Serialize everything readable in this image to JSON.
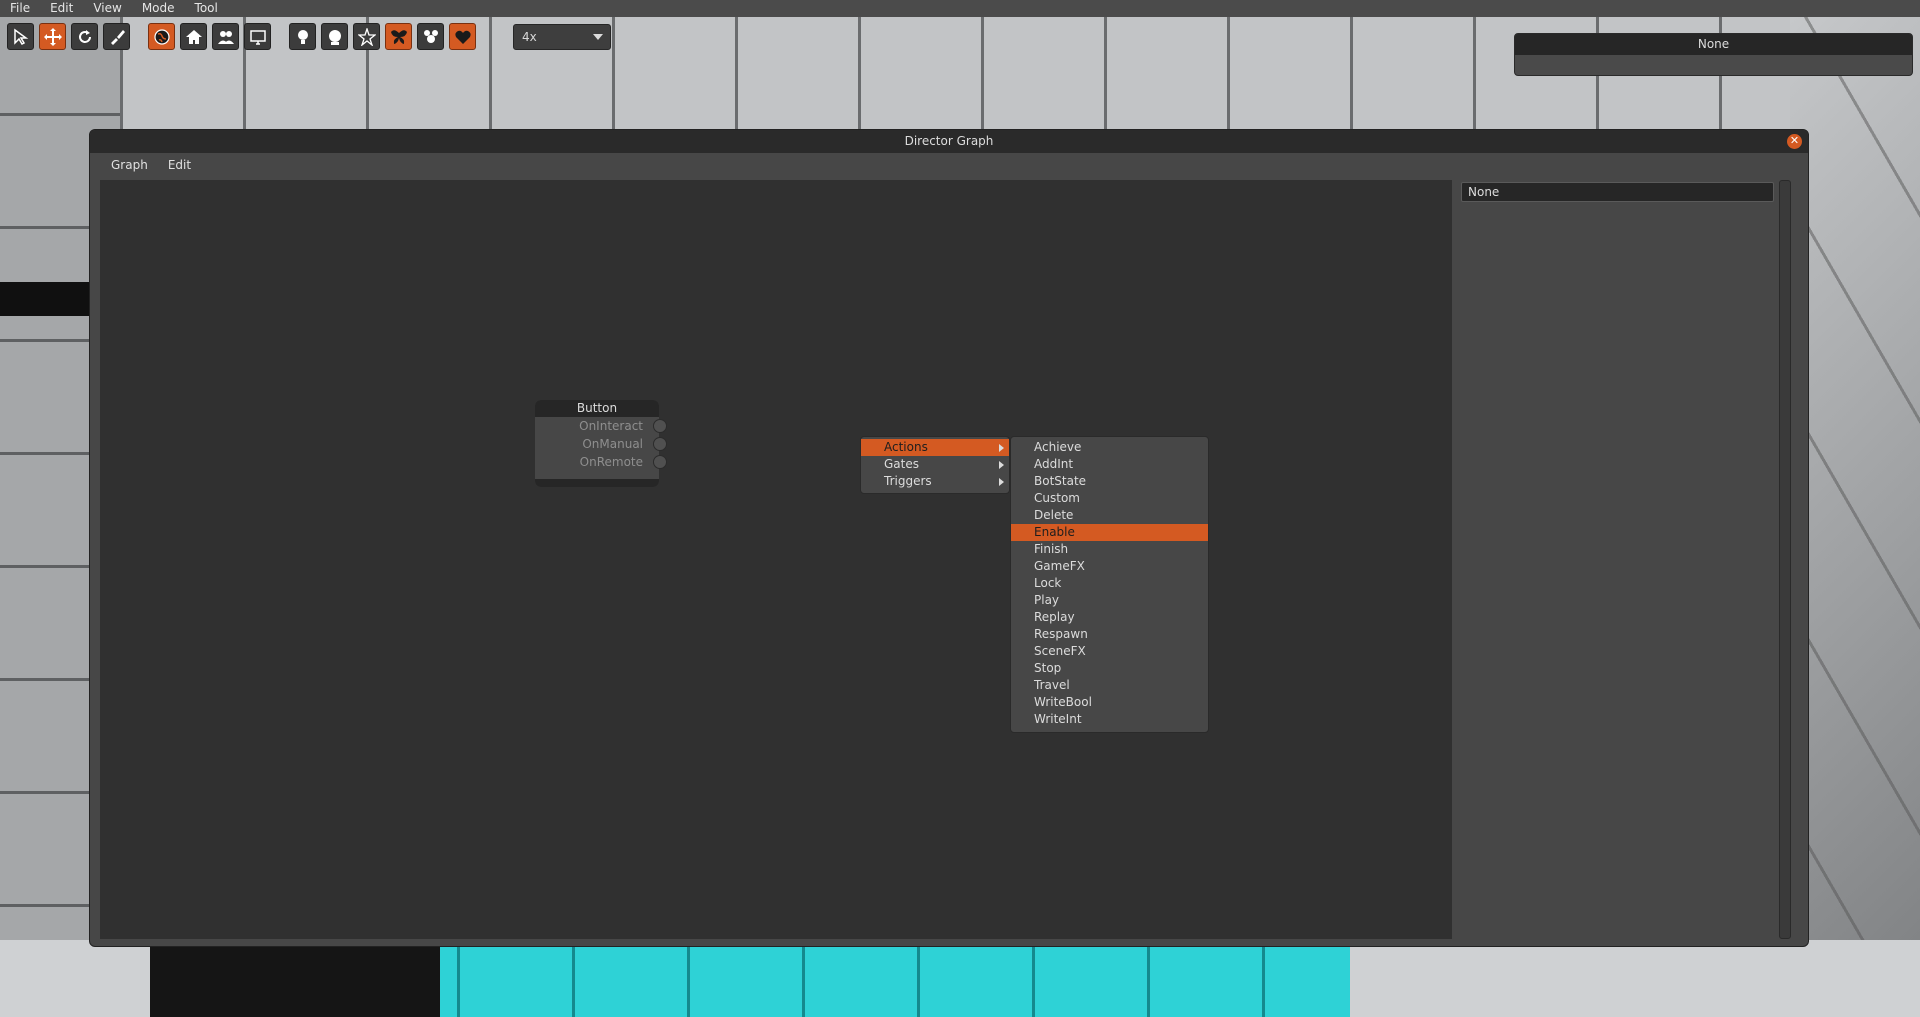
{
  "menubar": {
    "items": [
      "File",
      "Edit",
      "View",
      "Mode",
      "Tool"
    ]
  },
  "toolbar": {
    "tools": [
      {
        "icon": "select-arrow-icon",
        "active": false
      },
      {
        "icon": "move-arrows-icon",
        "active": true
      },
      {
        "icon": "rotate-icon",
        "active": false
      },
      {
        "icon": "paint-brush-icon",
        "active": false
      }
    ],
    "modes": [
      {
        "icon": "globe-icon",
        "active": true
      },
      {
        "icon": "house-icon",
        "active": false
      },
      {
        "icon": "users-icon",
        "active": false
      },
      {
        "icon": "monitor-icon",
        "active": false
      }
    ],
    "objects": [
      {
        "icon": "light-bulb-icon",
        "active": false
      },
      {
        "icon": "sphere-lamp-icon",
        "active": false
      },
      {
        "icon": "star-icon",
        "active": false
      },
      {
        "icon": "butterfly-icon",
        "active": true
      },
      {
        "icon": "character-icon",
        "active": false
      },
      {
        "icon": "heart-icon",
        "active": true
      }
    ],
    "zoom_value": "4x"
  },
  "top_panel": {
    "title": "None"
  },
  "window": {
    "title": "Director Graph",
    "menu": [
      "Graph",
      "Edit"
    ],
    "side_field": "None"
  },
  "node": {
    "title": "Button",
    "ports": [
      "OnInteract",
      "OnManual",
      "OnRemote"
    ]
  },
  "context_menu": {
    "categories": [
      {
        "label": "Actions",
        "selected": true
      },
      {
        "label": "Gates",
        "selected": false
      },
      {
        "label": "Triggers",
        "selected": false
      }
    ],
    "actions": [
      "Achieve",
      "AddInt",
      "BotState",
      "Custom",
      "Delete",
      "Enable",
      "Finish",
      "GameFX",
      "Lock",
      "Play",
      "Replay",
      "Respawn",
      "SceneFX",
      "Stop",
      "Travel",
      "WriteBool",
      "WriteInt"
    ],
    "highlighted_action": "Enable"
  },
  "colors": {
    "accent": "#d45a22",
    "panel": "#474747",
    "canvas": "#303030",
    "title_bar": "#2a2a2a"
  }
}
